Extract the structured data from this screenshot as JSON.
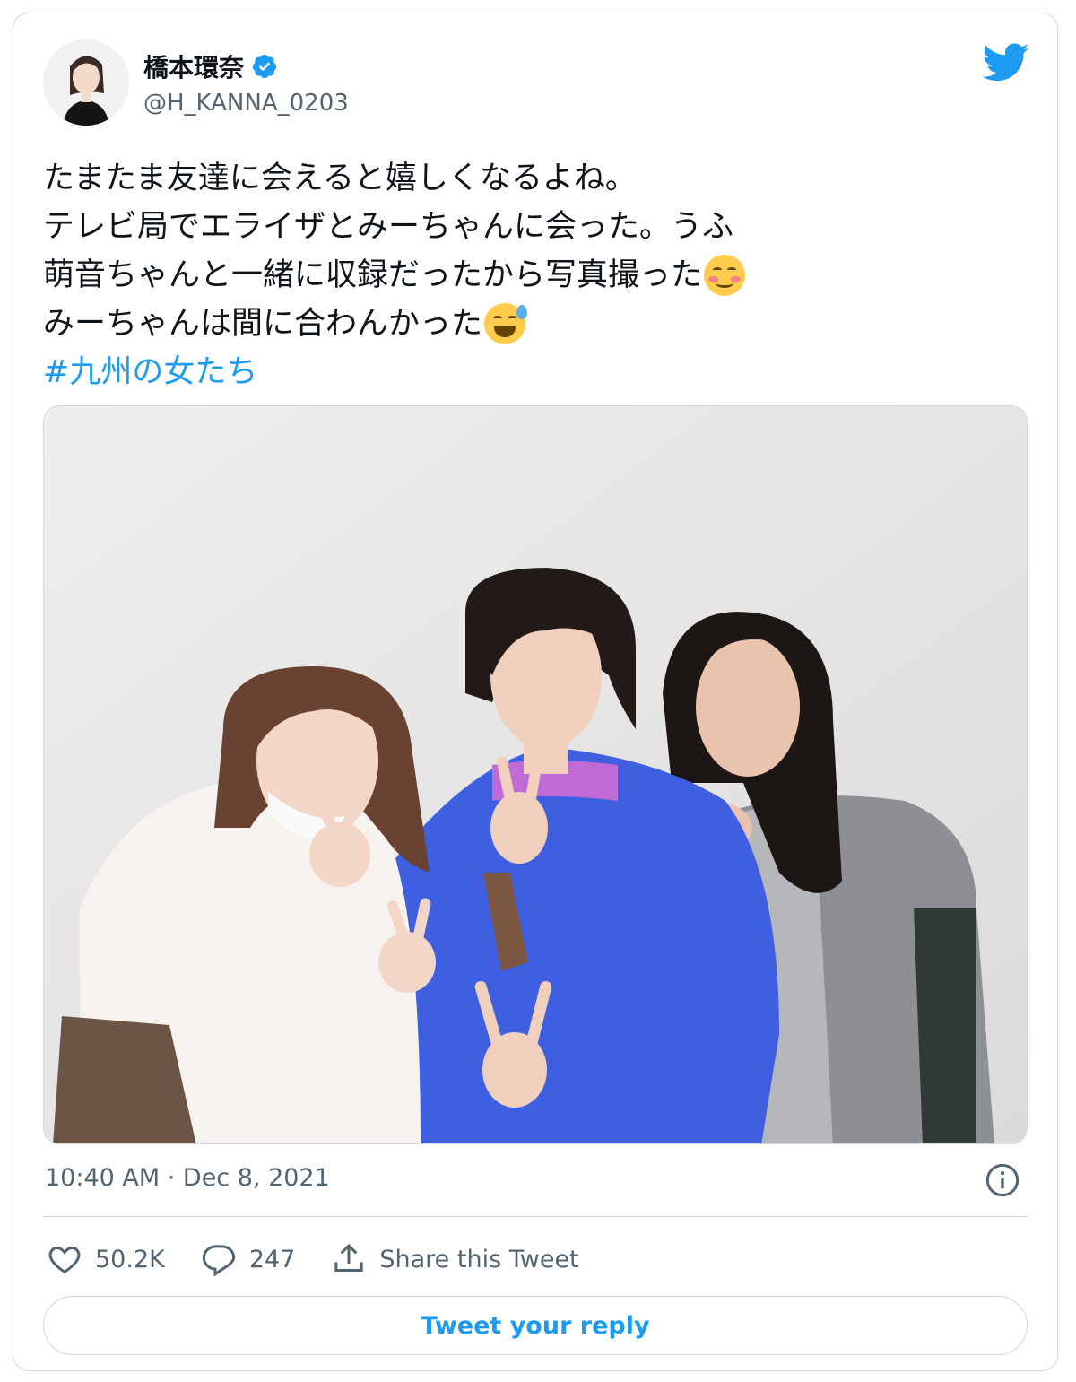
{
  "author": {
    "name": "橋本環奈",
    "handle": "@H_KANNA_0203",
    "verified": true
  },
  "icons": {
    "brand": "twitter-bird-icon",
    "verified": "verified-badge-icon",
    "info": "info-icon",
    "like": "heart-icon",
    "reply": "reply-bubble-icon",
    "share": "share-icon",
    "emoji_1": "smiling-face-with-smiling-eyes-emoji",
    "emoji_2": "grinning-face-with-sweat-emoji"
  },
  "tweet": {
    "lines": [
      "たまたま友達に会えると嬉しくなるよね。",
      "テレビ局でエライザとみーちゃんに会った。うふ",
      "萌音ちゃんと一緒に収録だったから写真撮った",
      "みーちゃんは間に合わんかった"
    ],
    "hashtag": "#九州の女たち",
    "timestamp": "10:40 AM · Dec 8, 2021"
  },
  "stats": {
    "likes": "50.2K",
    "replies": "247",
    "share_label": "Share this Tweet"
  },
  "reply_button_label": "Tweet your reply",
  "colors": {
    "accent": "#1d9bf0",
    "text": "#0f1419",
    "muted": "#536471",
    "border": "#cfd9de"
  }
}
